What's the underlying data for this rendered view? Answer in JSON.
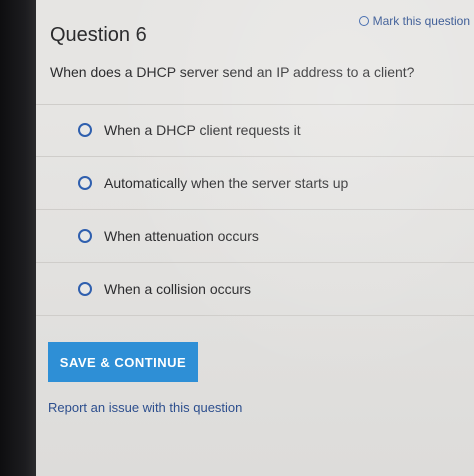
{
  "question": {
    "title": "Question 6",
    "mark_label": "Mark this question",
    "text": "When does a DHCP server send an IP address to a client?"
  },
  "options": [
    {
      "label": "When a DHCP client requests it",
      "selected": false
    },
    {
      "label": "Automatically when the server starts up",
      "selected": false
    },
    {
      "label": "When attenuation occurs",
      "selected": false
    },
    {
      "label": "When a collision occurs",
      "selected": false
    }
  ],
  "actions": {
    "save_label": "SAVE & CONTINUE",
    "report_label": "Report an issue with this question"
  },
  "colors": {
    "accent": "#2e8fd6",
    "link": "#2d4f8e",
    "radio": "#2f5fae"
  }
}
